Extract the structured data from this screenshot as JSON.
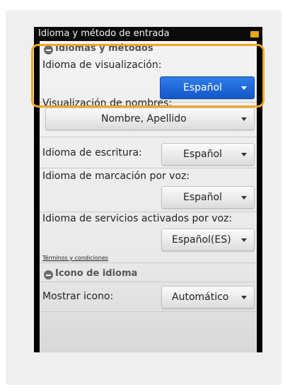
{
  "titlebar": {
    "title": "Idioma y método de entrada"
  },
  "section1": {
    "header": "Idiomas y métodos",
    "display_language": {
      "label": "Idioma de visualización:",
      "value": "Español"
    },
    "name_display": {
      "label": "Visualización de nombres:",
      "value": "Nombre, Apellido"
    },
    "input_language": {
      "label": "Idioma de escritura:",
      "value": "Español"
    },
    "voice_dial_language": {
      "label": "Idioma de marcación por voz:",
      "value": "Español"
    },
    "voice_services_language": {
      "label": "Idioma de servicios activados por voz:",
      "value": "Español(ES)"
    },
    "terms_link": "Términos y condiciones"
  },
  "section2": {
    "header": "Icono de idioma",
    "show_icon": {
      "label": "Mostrar icono:",
      "value": "Automático"
    }
  },
  "colors": {
    "accent": "#1e66d8",
    "highlight": "#f0a820"
  }
}
